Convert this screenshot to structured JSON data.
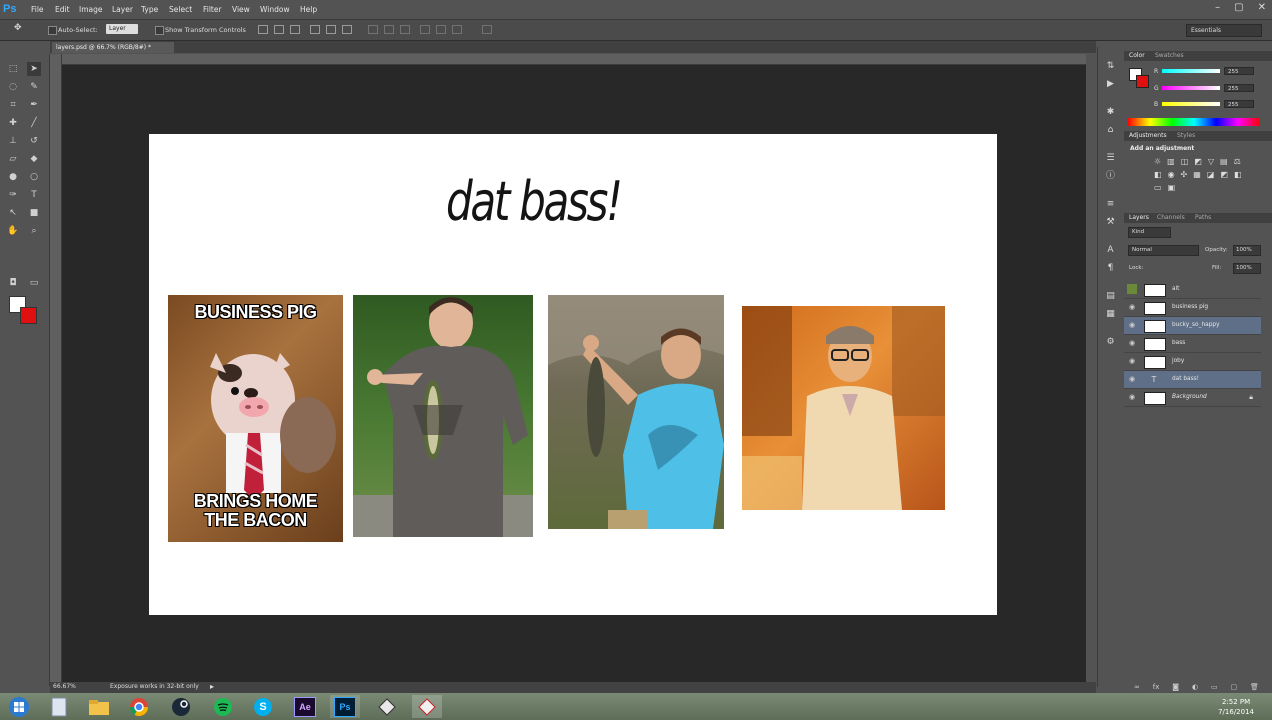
{
  "app": {
    "logo": "Ps",
    "accent": "#31a8ff"
  },
  "menu": [
    "File",
    "Edit",
    "Image",
    "Layer",
    "Type",
    "Select",
    "Filter",
    "View",
    "Window",
    "Help"
  ],
  "window_controls": [
    "–",
    "▢",
    "✕"
  ],
  "options_bar": {
    "auto_select_label": "Auto-Select:",
    "auto_select_target": "Layer",
    "show_transform_label": "Show Transform Controls",
    "workspace": "Essentials"
  },
  "document": {
    "tab_label": "layers.psd @ 66.7% (RGB/8#) *",
    "zoom": "66.67%",
    "status": "Exposure works in 32-bit only"
  },
  "canvas": {
    "title": "dat bass!",
    "background": "#ffffff",
    "photos": [
      {
        "name": "business pig",
        "top_text": "BUSINESS PIG",
        "bottom_text": "BRINGS HOME\nTHE BACON"
      },
      {
        "name": "bass"
      },
      {
        "name": "bucky_so_happy"
      },
      {
        "name": "joby"
      }
    ]
  },
  "tools": [
    "move",
    "marquee",
    "lasso",
    "quick-select",
    "crop",
    "eyedropper",
    "healing",
    "brush",
    "stamp",
    "history-brush",
    "eraser",
    "gradient",
    "blur",
    "dodge",
    "pen",
    "type",
    "path-select",
    "shape",
    "hand",
    "zoom"
  ],
  "colors": {
    "foreground": "#ffffff",
    "background": "#e01010"
  },
  "color_panel": {
    "tabs": [
      "Color",
      "Swatches"
    ],
    "channels": [
      {
        "label": "R",
        "value": "255",
        "gradient": "#00ffff"
      },
      {
        "label": "G",
        "value": "255",
        "gradient": "#ff00ff"
      },
      {
        "label": "B",
        "value": "255",
        "gradient": "#ffff00"
      }
    ]
  },
  "adjustments_panel": {
    "tabs": [
      "Adjustments",
      "Styles"
    ],
    "heading": "Add an adjustment"
  },
  "layers_panel": {
    "tabs": [
      "Layers",
      "Channels",
      "Paths"
    ],
    "filter": "Kind",
    "blend_mode": "Normal",
    "opacity_label": "Opacity:",
    "opacity": "100%",
    "lock_label": "Lock:",
    "fill_label": "Fill:",
    "fill": "100%",
    "layers": [
      {
        "name": "alt",
        "visible": false,
        "selected": false
      },
      {
        "name": "business pig",
        "visible": true,
        "selected": false
      },
      {
        "name": "bucky_so_happy",
        "visible": true,
        "selected": true
      },
      {
        "name": "bass",
        "visible": true,
        "selected": false
      },
      {
        "name": "joby",
        "visible": true,
        "selected": false
      },
      {
        "name": "dat bass!",
        "visible": true,
        "selected": true,
        "type": "text"
      },
      {
        "name": "Background",
        "visible": true,
        "selected": false,
        "locked": true
      }
    ]
  },
  "taskbar": {
    "apps": [
      "windows-start",
      "file-explorer-folder",
      "folder",
      "chrome",
      "steam",
      "spotify",
      "skype",
      "after-effects",
      "photoshop",
      "app-1",
      "app-2"
    ],
    "labels": {
      "ae": "Ae",
      "ps": "Ps",
      "skype": "S"
    },
    "time": "2:52 PM",
    "date": "7/16/2014"
  }
}
